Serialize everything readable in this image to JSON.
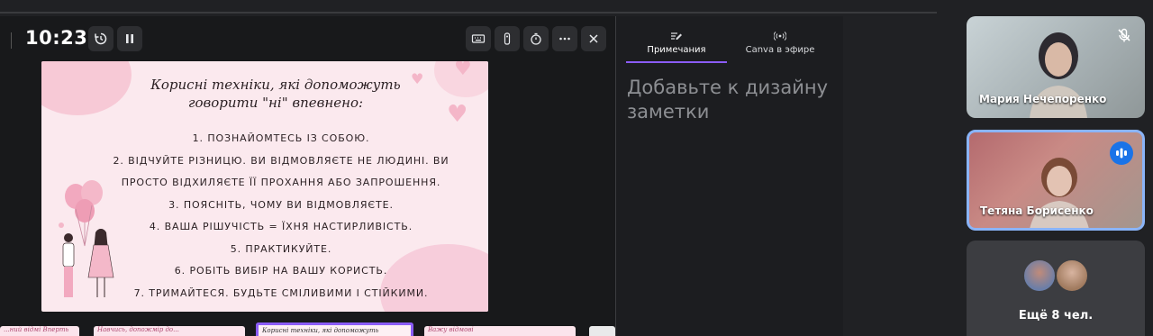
{
  "presenter": {
    "clock": "10:23",
    "toolbar": {
      "history_icon": "history-icon",
      "pause_icon": "pause-icon",
      "keyboard_icon": "keyboard-icon",
      "remote_icon": "remote-icon",
      "timer_icon": "timer-icon",
      "more_icon": "more-icon",
      "close_icon": "close-icon"
    },
    "slide": {
      "title_line1": "Корисні техніки, які допоможуть",
      "title_line2": "говорити \"ні\" впевнено:",
      "items": [
        "1. Познайомтесь із собою.",
        "2. Відчуйте різницю. Ви відмовляєте не людині. Ви",
        "просто відхиляєте її прохання або запрошення.",
        "3. Поясніть, чому ви відмовляєте.",
        "4. Ваша рішучість = їхня настирливість.",
        "5. Практикуйте.",
        "6. Робіть вибір на вашу користь.",
        "7. Тримайтеся. Будьте сміливими і стійкими."
      ]
    },
    "thumbnails": [
      {
        "label": "...ний відмі Вперть"
      },
      {
        "label": "Навчись, допожмір до..."
      },
      {
        "label": "Корисні техніки, які допоможуть"
      },
      {
        "label": "Важу відмові"
      },
      {
        "label": ""
      }
    ]
  },
  "notes_panel": {
    "tabs": [
      {
        "label": "Примечания",
        "icon": "notes-edit-icon"
      },
      {
        "label": "Canva в эфире",
        "icon": "broadcast-icon"
      }
    ],
    "placeholder": "Добавьте к дизайну заметки"
  },
  "participants": [
    {
      "name": "Мария Нечепоренко",
      "status_icon": "mic-off-icon"
    },
    {
      "name": "Тетяна Борисенко",
      "status_icon": "speaking-icon",
      "active": true
    }
  ],
  "more_participants": {
    "label": "Ещё 8 чел."
  },
  "colors": {
    "accent": "#8b5cf6",
    "speaking_blue": "#1a73e8",
    "slide_bg": "#fbe9ee"
  }
}
